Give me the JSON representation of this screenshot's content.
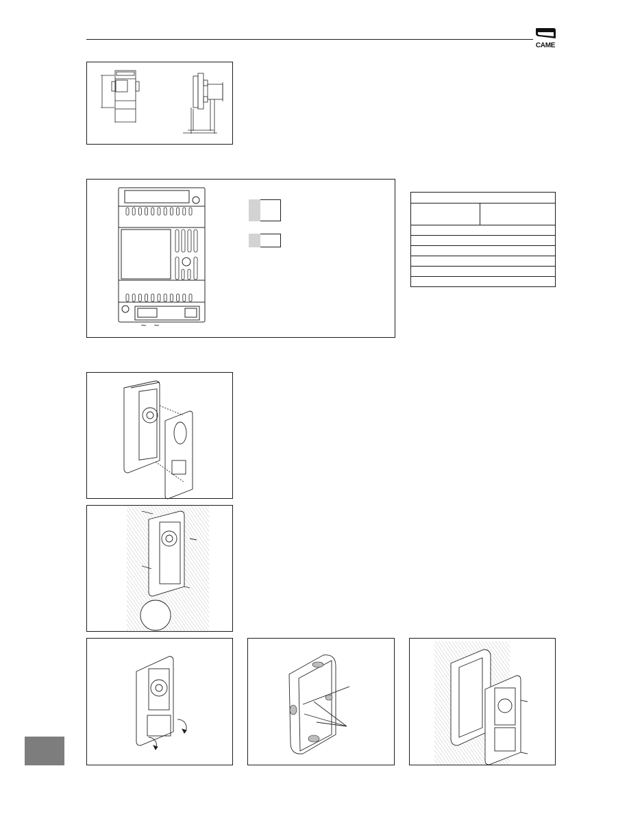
{
  "header": {
    "brand_logo_text": "CAME",
    "brand_logo_icon": "came-logo-icon"
  },
  "figures": {
    "dimensions": {
      "label": "",
      "description": "Power supply dimensions drawing (front and side view)"
    },
    "terminals": {
      "label": "",
      "description": "Power supply front with terminal blocks",
      "terminal_symbols": [
        "~",
        "~"
      ],
      "legend": [
        {
          "swatch": "grey",
          "text": ""
        },
        {
          "swatch": "grey",
          "text": ""
        }
      ]
    },
    "spec_table": {
      "rows": [
        [
          ""
        ],
        [
          "",
          ""
        ],
        [
          ""
        ],
        [
          ""
        ],
        [
          ""
        ],
        [
          ""
        ],
        [
          ""
        ],
        [
          ""
        ]
      ]
    },
    "step_front_cover": {
      "description": "Removing front cover from entry panel"
    },
    "step_wall_mount": {
      "description": "Surface mounting panel on wall with screws"
    },
    "step_open_flaps": {
      "description": "Opening cable entry flaps"
    },
    "step_flush_box": {
      "description": "Flush mounting box with knock-outs"
    },
    "step_flush_mount": {
      "description": "Fixing panel into flush frame with screws"
    }
  },
  "language_tab": {
    "color": "#7d7d7d",
    "text": ""
  },
  "colors": {
    "line": "#1a1a1a",
    "swatch_grey": "#d3d3d3",
    "tab_grey": "#7d7d7d"
  }
}
